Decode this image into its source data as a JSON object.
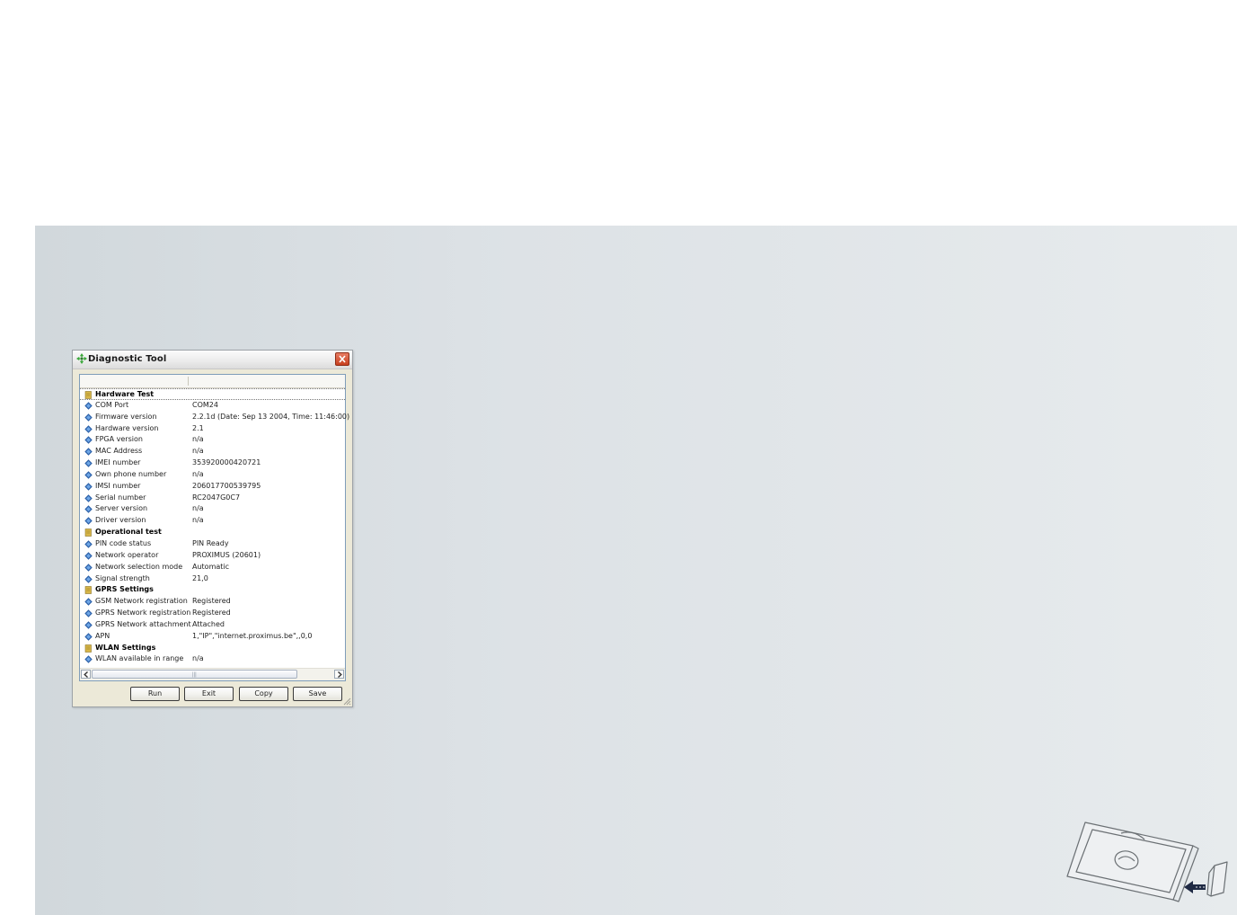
{
  "window": {
    "title": "Diagnostic Tool",
    "title_icon": "green-cross-diamond-icon",
    "close_icon": "close-icon"
  },
  "listview": {
    "rows": [
      {
        "type": "group",
        "label": "Hardware Test",
        "value": ""
      },
      {
        "type": "item",
        "label": "COM Port",
        "value": "COM24"
      },
      {
        "type": "item",
        "label": "Firmware version",
        "value": "2.2.1d  (Date: Sep 13 2004, Time: 11:46:00)"
      },
      {
        "type": "item",
        "label": "Hardware version",
        "value": "2.1"
      },
      {
        "type": "item",
        "label": "FPGA version",
        "value": "n/a"
      },
      {
        "type": "item",
        "label": "MAC Address",
        "value": "n/a"
      },
      {
        "type": "item",
        "label": "IMEI number",
        "value": "353920000420721"
      },
      {
        "type": "item",
        "label": "Own phone number",
        "value": "n/a"
      },
      {
        "type": "item",
        "label": "IMSI number",
        "value": "206017700539795"
      },
      {
        "type": "item",
        "label": "Serial number",
        "value": "RC2047G0C7"
      },
      {
        "type": "item",
        "label": "Server version",
        "value": "n/a"
      },
      {
        "type": "item",
        "label": "Driver version",
        "value": "n/a"
      },
      {
        "type": "group",
        "label": "Operational test",
        "value": ""
      },
      {
        "type": "item",
        "label": "PIN code status",
        "value": "PIN Ready"
      },
      {
        "type": "item",
        "label": "Network operator",
        "value": "PROXIMUS (20601)"
      },
      {
        "type": "item",
        "label": "Network selection mode",
        "value": "Automatic"
      },
      {
        "type": "item",
        "label": "Signal strength",
        "value": "21,0"
      },
      {
        "type": "group",
        "label": "GPRS Settings",
        "value": ""
      },
      {
        "type": "item",
        "label": "GSM Network registration",
        "value": "Registered"
      },
      {
        "type": "item",
        "label": "GPRS Network registration",
        "value": "Registered"
      },
      {
        "type": "item",
        "label": "GPRS Network attachment",
        "value": "Attached"
      },
      {
        "type": "item",
        "label": "APN",
        "value": "1,\"IP\",\"internet.proximus.be\",,0,0"
      },
      {
        "type": "group",
        "label": "WLAN Settings",
        "value": ""
      },
      {
        "type": "item",
        "label": "WLAN available in range",
        "value": "n/a"
      }
    ]
  },
  "buttons": {
    "run": "Run",
    "exit": "Exit",
    "copy": "Copy",
    "save": "Save"
  },
  "icons": {
    "group": "folder-note-icon",
    "item": "blue-diamond-icon",
    "scroll_left": "chevron-left-icon",
    "scroll_right": "chevron-right-icon",
    "illustration": "pc-card-insert-illustration"
  },
  "colors": {
    "panel_bg": "#dde2e6",
    "item_icon": "#2a5fa8",
    "group_icon": "#d8b648"
  }
}
